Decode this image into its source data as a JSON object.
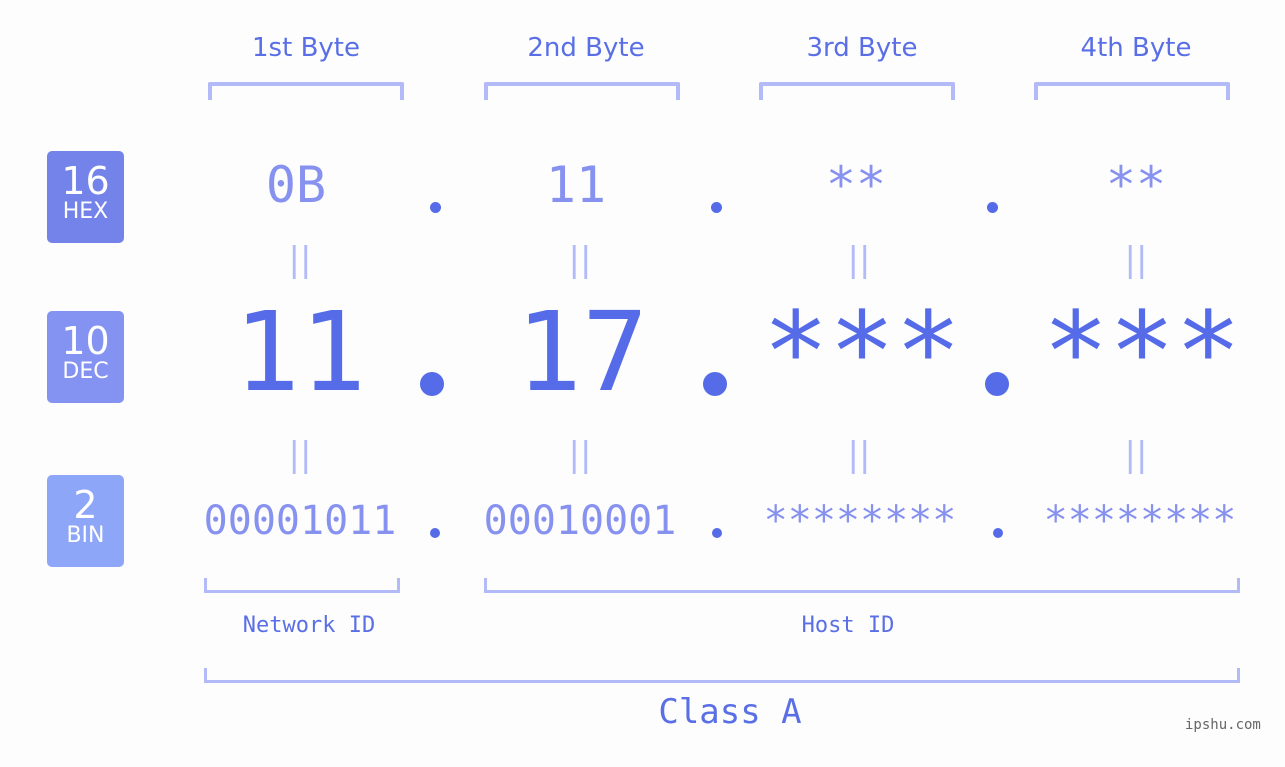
{
  "headers": [
    "1st Byte",
    "2nd Byte",
    "3rd Byte",
    "4th Byte"
  ],
  "badges": [
    {
      "num": "16",
      "label": "HEX",
      "color": "#7383ea"
    },
    {
      "num": "10",
      "label": "DEC",
      "color": "#8492f2"
    },
    {
      "num": "2",
      "label": "BIN",
      "color": "#8ea6f8"
    }
  ],
  "hex": [
    "0B",
    "11",
    "**",
    "**"
  ],
  "dec": [
    "11",
    "17",
    "***",
    "***"
  ],
  "bin": [
    "00001011",
    "00010001",
    "********",
    "********"
  ],
  "equals": "||",
  "labels": {
    "network": "Network ID",
    "host": "Host ID",
    "class": "Class A"
  },
  "watermark": "ipshu.com"
}
